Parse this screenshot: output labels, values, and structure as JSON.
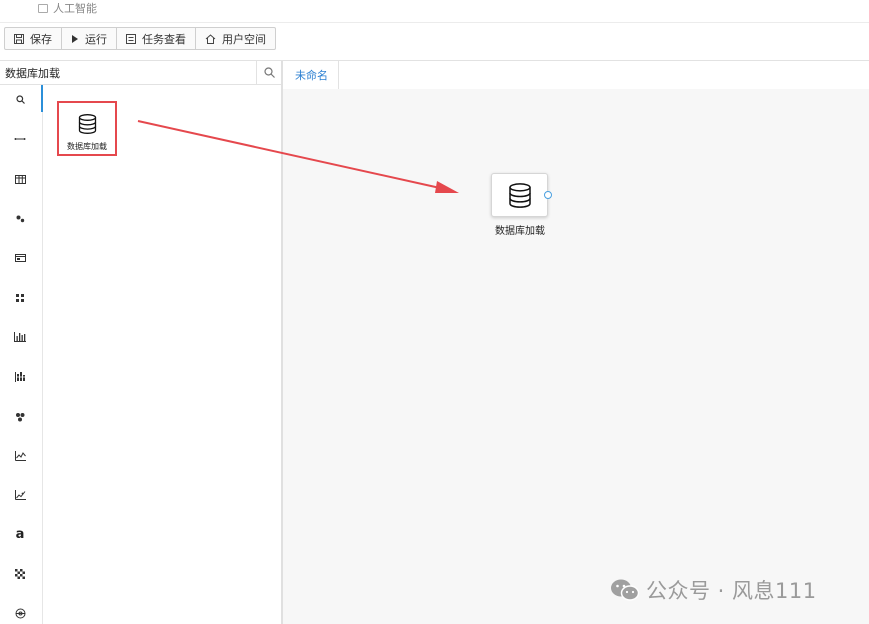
{
  "app": {
    "title": "人工智能"
  },
  "toolbar": {
    "save": "保存",
    "run": "运行",
    "tasks": "任务查看",
    "user_space": "用户空间"
  },
  "search": {
    "value": "数据库加载"
  },
  "palette": {
    "component_label": "数据库加载"
  },
  "tabs": [
    {
      "label": "未命名"
    }
  ],
  "canvas": {
    "node_label": "数据库加载"
  },
  "rail_icons": [
    "search-icon",
    "dots-line-icon",
    "table-icon",
    "nodes-icon",
    "card-icon",
    "grid-icon",
    "bar-chart-icon",
    "stacked-grid-icon",
    "cluster-icon",
    "line-chart-icon",
    "scatter-chart-icon",
    "text-a-icon",
    "checker-icon",
    "network-icon"
  ],
  "colors": {
    "accent": "#2b8fd9",
    "highlight_box": "#e5484d",
    "arrow": "#e5484d"
  },
  "watermark": {
    "text": "公众号 · 风息111"
  }
}
